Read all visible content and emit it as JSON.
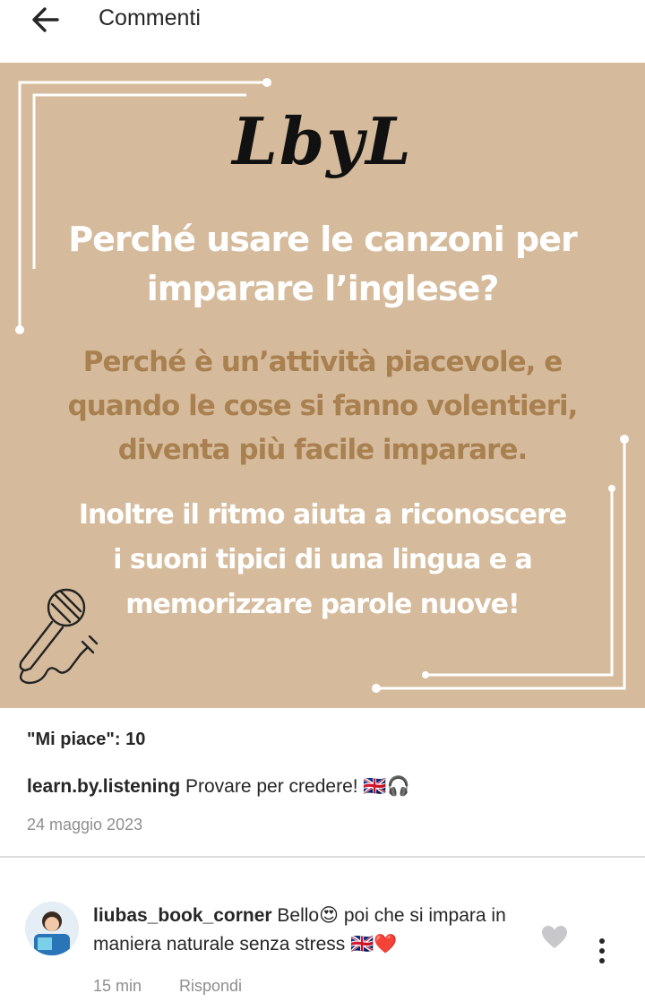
{
  "header": {
    "title": "Commenti",
    "back_icon": "arrow-left-icon"
  },
  "post": {
    "image": {
      "background": "#d5bb9c",
      "logo": "LbyL",
      "headline_lines": [
        "Perché usare le canzoni per",
        "imparare l’inglese?"
      ],
      "body1_lines": [
        "Perché è un’attività piacevole, e",
        "quando le cose si fanno volentieri,",
        "diventa più facile imparare."
      ],
      "body2_lines": [
        "Inoltre il ritmo aiuta  a riconoscere",
        "i suoni tipici di una lingua e a",
        "memorizzare  parole nuove!"
      ],
      "accent_color": "#a9804f",
      "illustration_icon": "microphone-icon"
    },
    "likes_label": "\"Mi piace\": 10",
    "caption": {
      "user": "learn.by.listening",
      "text": "Provare per credere! 🇬🇧🎧"
    },
    "date": "24 maggio 2023"
  },
  "comment": {
    "user": "liubas_book_corner",
    "text": "Bello😍  poi che si impara in maniera naturale senza stress 🇬🇧❤️",
    "time": "15 min",
    "reply_label": "Rispondi",
    "like_icon": "heart-icon",
    "more_icon": "more-vertical-icon"
  }
}
